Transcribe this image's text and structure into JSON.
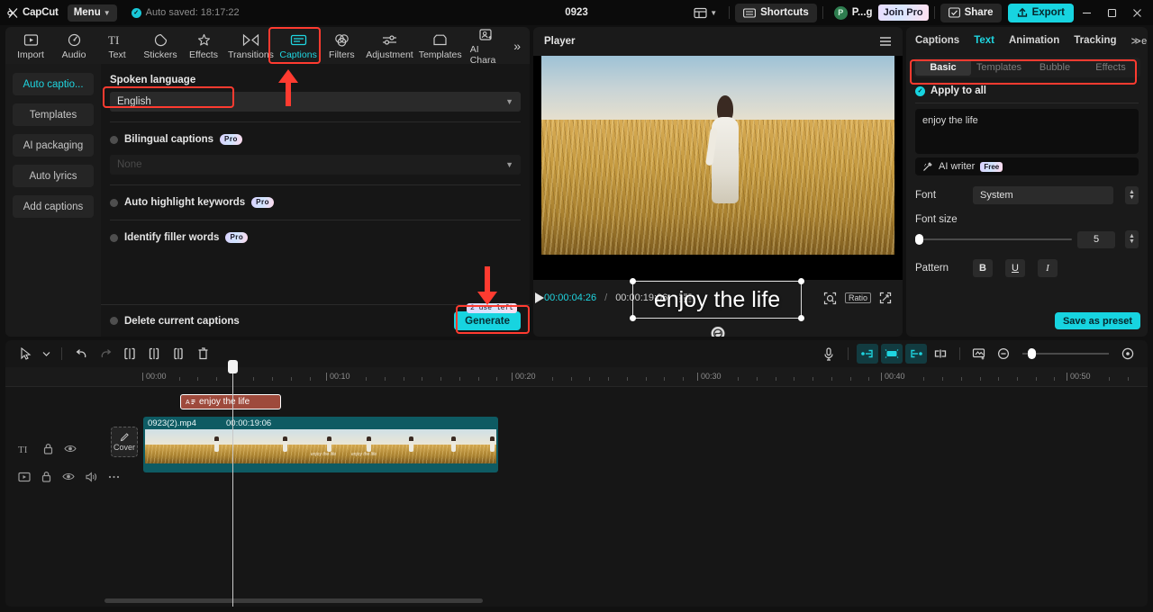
{
  "titlebar": {
    "brand": "CapCut",
    "menu_label": "Menu",
    "autosave_text": "Auto saved: 18:17:22",
    "project_title": "0923",
    "layout_icon": "layout-icon",
    "shortcuts_label": "Shortcuts",
    "account_initial": "P",
    "account_name": "P...g",
    "join_pro_label": "Join Pro",
    "share_label": "Share",
    "export_label": "Export",
    "minimize_label": "—",
    "maximize_label": "▢",
    "close_label": "✕"
  },
  "tooltabs": {
    "items": [
      {
        "label": "Import",
        "icon": "import-icon"
      },
      {
        "label": "Audio",
        "icon": "audio-icon"
      },
      {
        "label": "Text",
        "icon": "text-icon"
      },
      {
        "label": "Stickers",
        "icon": "stickers-icon"
      },
      {
        "label": "Effects",
        "icon": "effects-icon"
      },
      {
        "label": "Transitions",
        "icon": "transitions-icon"
      },
      {
        "label": "Captions",
        "icon": "captions-icon"
      },
      {
        "label": "Filters",
        "icon": "filters-icon"
      },
      {
        "label": "Adjustment",
        "icon": "adjustment-icon"
      },
      {
        "label": "Templates",
        "icon": "templates-icon"
      },
      {
        "label": "AI Chara",
        "icon": "ai-character-icon"
      }
    ],
    "active": "Captions",
    "overflow_label": "»"
  },
  "subnav": {
    "items": [
      {
        "label": "Auto captio..."
      },
      {
        "label": "Templates"
      },
      {
        "label": "AI packaging"
      },
      {
        "label": "Auto lyrics"
      },
      {
        "label": "Add captions"
      }
    ],
    "active_index": 0
  },
  "captions_panel": {
    "spoken_language_label": "Spoken language",
    "spoken_language_value": "English",
    "bilingual_label": "Bilingual captions",
    "bilingual_badge": "Pro",
    "bilingual_value": "None",
    "auto_highlight_label": "Auto highlight keywords",
    "auto_highlight_badge": "Pro",
    "filler_words_label": "Identify filler words",
    "filler_words_badge": "Pro",
    "delete_captions_label": "Delete current captions",
    "uses_left": "2 use left",
    "generate_label": "Generate"
  },
  "player": {
    "title": "Player",
    "menu_icon": "hamburger-icon",
    "caption_overlay_text": "enjoy the life",
    "rotate_icon": "rotate-icon",
    "current_time": "00:00:04:26",
    "time_separator": "/",
    "total_time": "00:00:19:06",
    "frames_icon": "frames-icon",
    "play_icon": "play-icon",
    "snapshot_icon": "snapshot-icon",
    "ratio_label": "Ratio",
    "fullscreen_icon": "fullscreen-icon"
  },
  "right_panel": {
    "tabs": [
      {
        "label": "Captions"
      },
      {
        "label": "Text"
      },
      {
        "label": "Animation"
      },
      {
        "label": "Tracking"
      }
    ],
    "active_tab": "Text",
    "overflow_label": "≫e",
    "segments": [
      {
        "label": "Basic"
      },
      {
        "label": "Templates"
      },
      {
        "label": "Bubble"
      },
      {
        "label": "Effects"
      }
    ],
    "active_segment": "Basic",
    "apply_to_all_label": "Apply to all",
    "apply_to_all_checked": true,
    "text_value": "enjoy the life",
    "ai_writer_label": "AI writer",
    "ai_writer_badge": "Free",
    "font_label": "Font",
    "font_value": "System",
    "font_size_label": "Font size",
    "font_size_value": "5",
    "pattern_label": "Pattern",
    "pattern_bold": "B",
    "pattern_underline": "U",
    "pattern_italic": "I",
    "save_preset_label": "Save as preset"
  },
  "timeline": {
    "toolbar": {
      "select_icon": "cursor-select-icon",
      "select_caret": "chevron-down-icon",
      "undo_icon": "undo-icon",
      "redo_icon": "redo-icon",
      "split_icon": "split-icon",
      "trim_left_icon": "trim-left-icon",
      "trim_right_icon": "trim-right-icon",
      "delete_icon": "delete-icon",
      "mic_icon": "microphone-icon",
      "keyframe_in_icon": "keyframe-in-icon",
      "auto_enhance_icon": "auto-enhance-icon",
      "keyframe_out_icon": "keyframe-out-icon",
      "mirror_icon": "mirror-icon",
      "crop_icon": "crop-icon",
      "zoom_out_icon": "zoom-out-icon",
      "zoom_fit_icon": "zoom-fit-icon"
    },
    "ruler_labels": [
      "00:00",
      "00:10",
      "00:20",
      "00:30",
      "00:40",
      "00:50"
    ],
    "text_track": {
      "type_icon": "text-track-icon",
      "lock_icon": "lock-icon",
      "eye_icon": "eye-icon",
      "clip_icon": "caption-clip-icon",
      "clip_label": "enjoy the life"
    },
    "video_track": {
      "type_icon": "video-track-icon",
      "lock_icon": "lock-icon",
      "eye_icon": "eye-icon",
      "volume_icon": "volume-icon",
      "more_icon": "more-icon",
      "cover_label": "Cover",
      "cover_icon": "pencil-icon",
      "clip_name": "0923(2).mp4",
      "clip_duration": "00:00:19:06",
      "thumb_caption": "enjoy the life"
    }
  },
  "annotations": {
    "accent_color": "#ff3b30",
    "boxes": [
      {
        "name": "captions-tab-highlight"
      },
      {
        "name": "spoken-language-highlight"
      },
      {
        "name": "generate-button-highlight"
      },
      {
        "name": "basic-tab-highlight"
      }
    ]
  },
  "colors": {
    "accent_cyan": "#17d4e0",
    "annotation_red": "#ff3b30",
    "panel_bg": "#1a1a1a",
    "app_bg": "#111111",
    "text_clip": "#9e4a3c",
    "video_clip": "#0e5b63"
  }
}
